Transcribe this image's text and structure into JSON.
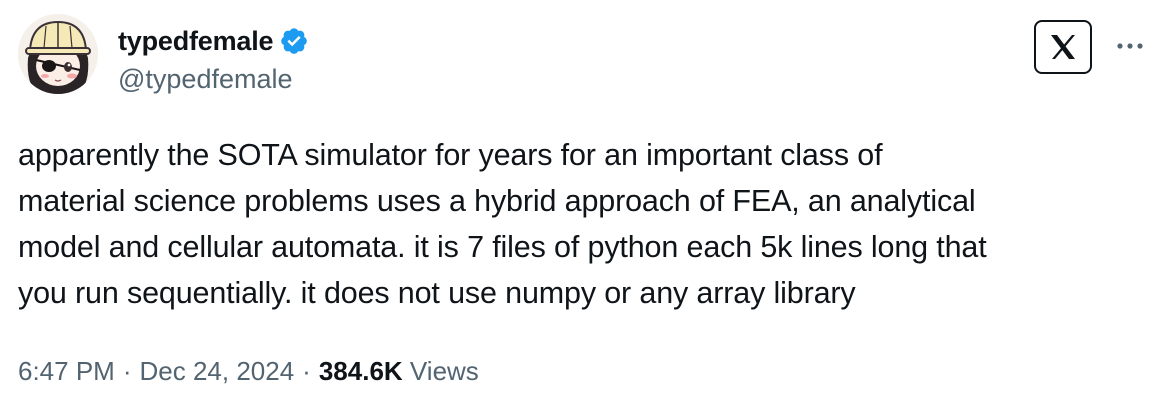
{
  "author": {
    "display_name": "typedfemale",
    "handle": "@typedfemale",
    "verified": true,
    "avatar_icon": "anime-girl-avatar-icon"
  },
  "header": {
    "logo_icon": "x-logo-icon",
    "more_icon": "more-horizontal-icon"
  },
  "tweet": {
    "text": "apparently the SOTA simulator for years for an important class of\nmaterial science problems uses a hybrid approach of FEA, an analytical\nmodel and cellular automata. it is 7 files of python each 5k lines long that\nyou run sequentially. it does not use numpy or any array library"
  },
  "meta": {
    "time": "6:47 PM",
    "separator": "·",
    "date": "Dec 24, 2024",
    "views_count": "384.6K",
    "views_label": "Views"
  },
  "colors": {
    "verified_blue": "#1d9bf0",
    "text_primary": "#0f1419",
    "text_secondary": "#536471"
  }
}
